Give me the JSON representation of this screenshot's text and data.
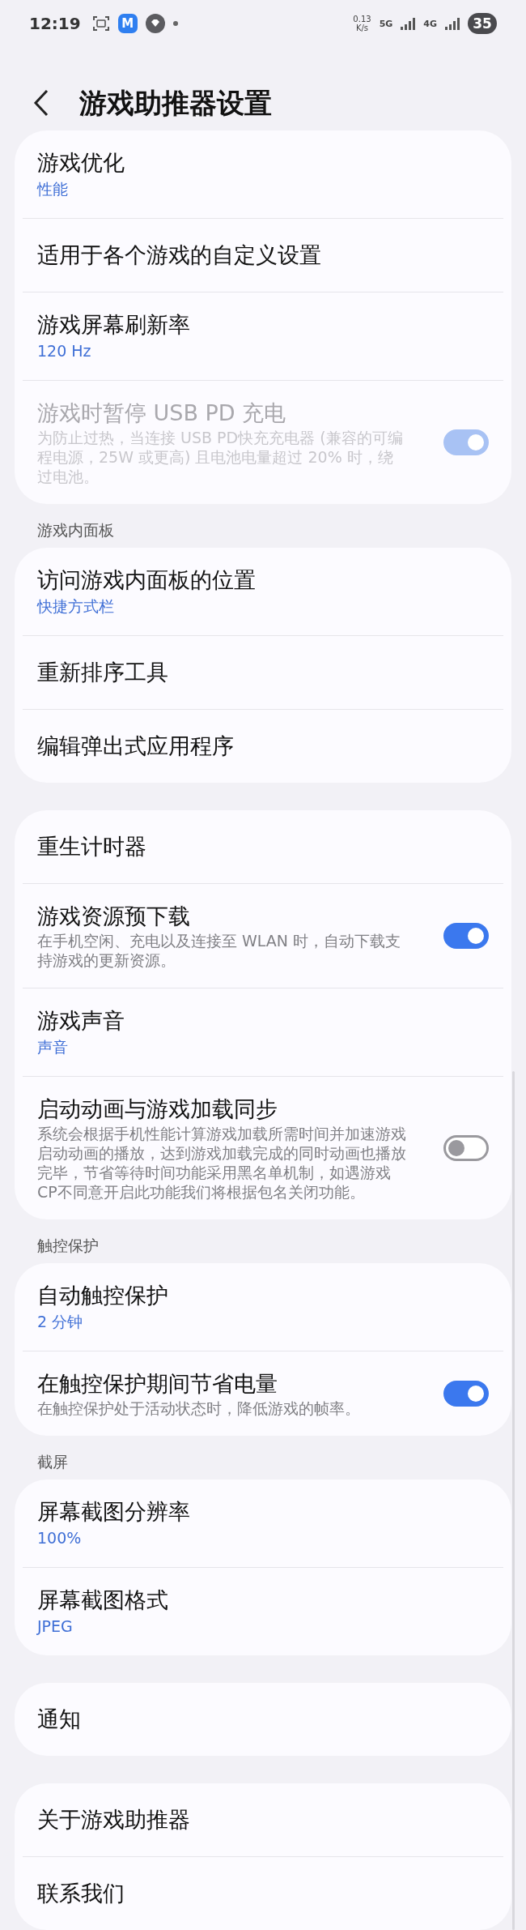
{
  "status_bar": {
    "time": "12:19",
    "app_icon_letter": "M",
    "network_speed": "0.13",
    "network_speed_unit": "K/s",
    "network_type_1": "5G",
    "network_type_2": "4G",
    "battery": "35"
  },
  "header": {
    "title": "游戏助推器设置"
  },
  "groups": [
    {
      "items": [
        {
          "kind": "value",
          "title": "游戏优化",
          "value": "性能"
        },
        {
          "kind": "link",
          "title": "适用于各个游戏的自定义设置"
        },
        {
          "kind": "value",
          "title": "游戏屏幕刷新率",
          "value": "120 Hz"
        },
        {
          "kind": "toggle",
          "title": "游戏时暂停 USB PD 充电",
          "description": "为防止过热，当连接 USB PD快充充电器 (兼容的可编程电源，25W 或更高) 且电池电量超过 20% 时，绕过电池。",
          "on": true,
          "disabled": true
        }
      ]
    },
    {
      "header": "游戏内面板",
      "items": [
        {
          "kind": "value",
          "title": "访问游戏内面板的位置",
          "value": "快捷方式栏"
        },
        {
          "kind": "link",
          "title": "重新排序工具"
        },
        {
          "kind": "link",
          "title": "编辑弹出式应用程序"
        }
      ]
    },
    {
      "items": [
        {
          "kind": "link",
          "title": "重生计时器"
        },
        {
          "kind": "toggle",
          "title": "游戏资源预下载",
          "description": "在手机空闲、充电以及连接至 WLAN 时，自动下载支持游戏的更新资源。",
          "on": true,
          "disabled": false
        },
        {
          "kind": "value",
          "title": "游戏声音",
          "value": "声音"
        },
        {
          "kind": "toggle",
          "title": "启动动画与游戏加载同步",
          "description": "系统会根据手机性能计算游戏加载所需时间并加速游戏启动动画的播放，达到游戏加载完成的同时动画也播放完毕，节省等待时间功能采用黑名单机制，如遇游戏CP不同意开启此功能我们将根据包名关闭功能。",
          "on": false,
          "disabled": false
        }
      ]
    },
    {
      "header": "触控保护",
      "items": [
        {
          "kind": "value",
          "title": "自动触控保护",
          "value": "2 分钟"
        },
        {
          "kind": "toggle",
          "title": "在触控保护期间节省电量",
          "description": "在触控保护处于活动状态时，降低游戏的帧率。",
          "on": true,
          "disabled": false
        }
      ]
    },
    {
      "header": "截屏",
      "items": [
        {
          "kind": "value",
          "title": "屏幕截图分辨率",
          "value": "100%"
        },
        {
          "kind": "value",
          "title": "屏幕截图格式",
          "value": "JPEG"
        }
      ]
    },
    {
      "items": [
        {
          "kind": "link",
          "title": "通知"
        }
      ]
    },
    {
      "items": [
        {
          "kind": "link",
          "title": "关于游戏助推器"
        },
        {
          "kind": "link",
          "title": "联系我们"
        }
      ]
    }
  ]
}
